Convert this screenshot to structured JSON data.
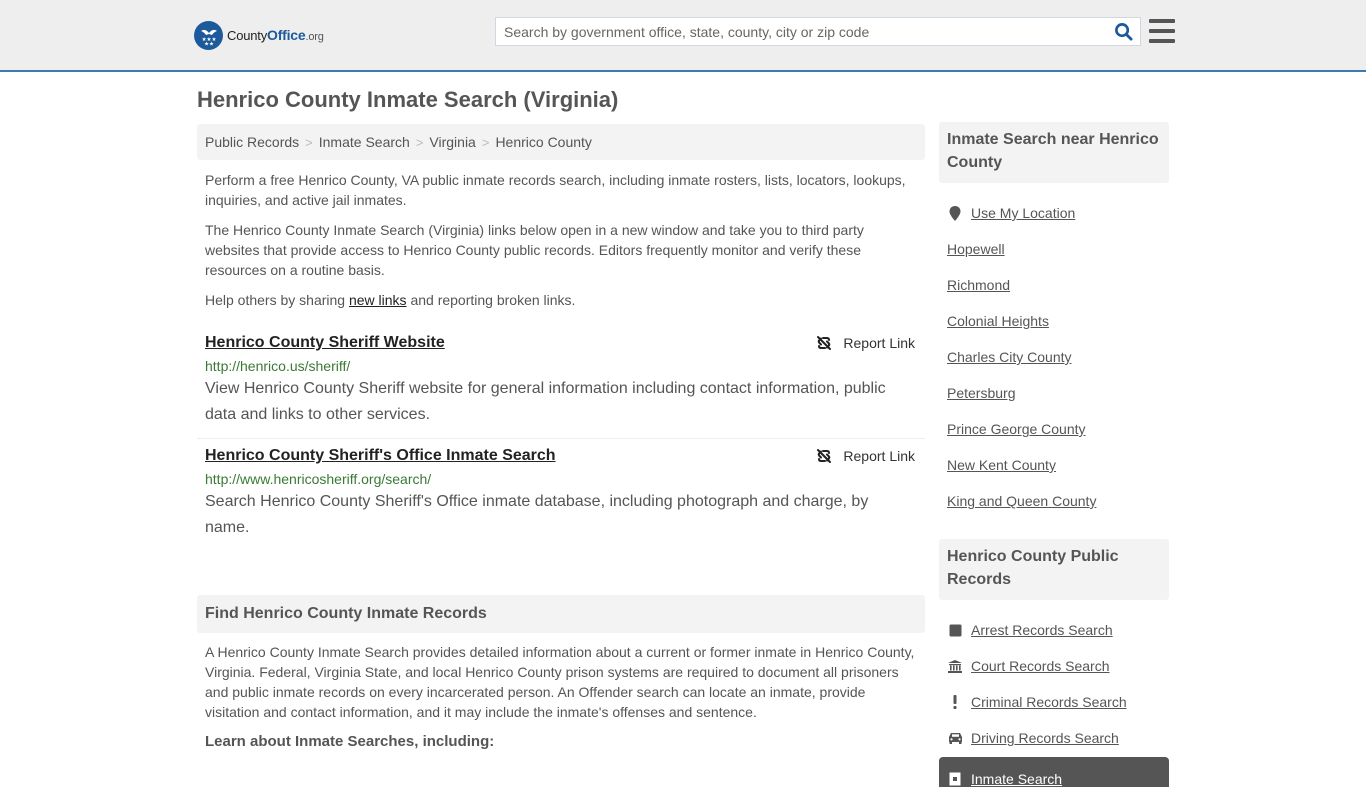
{
  "header": {
    "logo": {
      "name_prefix": "County",
      "name_brand": "Office",
      "name_suffix": ".org"
    },
    "search": {
      "placeholder": "Search by government office, state, county, city or zip code",
      "value": ""
    },
    "icons": {
      "search": "search-icon",
      "menu": "hamburger-menu-icon"
    }
  },
  "page": {
    "title": "Henrico County Inmate Search (Virginia)"
  },
  "breadcrumb": [
    {
      "label": "Public Records"
    },
    {
      "label": "Inmate Search"
    },
    {
      "label": "Virginia"
    },
    {
      "label": "Henrico County"
    }
  ],
  "breadcrumb_separator": ">",
  "intro": {
    "p1": "Perform a free Henrico County, VA public inmate records search, including inmate rosters, lists, locators, lookups, inquiries, and active jail inmates.",
    "p2": "The Henrico County Inmate Search (Virginia) links below open in a new window and take you to third party websites that provide access to Henrico County public records. Editors frequently monitor and verify these resources on a routine basis.",
    "p3_before": "Help others by sharing ",
    "p3_link": "new links",
    "p3_after": " and reporting broken links."
  },
  "links": [
    {
      "title": "Henrico County Sheriff Website",
      "url": "http://henrico.us/sheriff/",
      "description": "View Henrico County Sheriff website for general information including contact information, public data and links to other services.",
      "report_label": "Report Link"
    },
    {
      "title": "Henrico County Sheriff's Office Inmate Search",
      "url": "http://www.henricosheriff.org/search/",
      "description": "Search Henrico County Sheriff's Office inmate database, including photograph and charge, by name.",
      "report_label": "Report Link"
    }
  ],
  "find_section": {
    "heading": "Find Henrico County Inmate Records",
    "body": "A Henrico County Inmate Search provides detailed information about a current or former inmate in Henrico County, Virginia. Federal, Virginia State, and local Henrico County prison systems are required to document all prisoners and public inmate records on every incarcerated person. An Offender search can locate an inmate, provide visitation and contact information, and it may include the inmate's offenses and sentence.",
    "learn_heading": "Learn about Inmate Searches, including:"
  },
  "sidebar": {
    "nearby": {
      "heading": "Inmate Search near Henrico County",
      "use_location": "Use My Location",
      "items": [
        {
          "label": "Hopewell"
        },
        {
          "label": "Richmond"
        },
        {
          "label": "Colonial Heights"
        },
        {
          "label": "Charles City County"
        },
        {
          "label": "Petersburg"
        },
        {
          "label": "Prince George County"
        },
        {
          "label": "New Kent County"
        },
        {
          "label": "King and Queen County"
        }
      ]
    },
    "public_records": {
      "heading": "Henrico County Public Records",
      "items": [
        {
          "label": "Arrest Records Search",
          "icon": "arrest-book-icon"
        },
        {
          "label": "Court Records Search",
          "icon": "courthouse-icon"
        },
        {
          "label": "Criminal Records Search",
          "icon": "exclamation-icon"
        },
        {
          "label": "Driving Records Search",
          "icon": "car-icon"
        }
      ],
      "active": {
        "label": "Inmate Search",
        "icon": "jail-door-icon"
      }
    }
  },
  "colors": {
    "header_bg": "#eeeeee",
    "header_border": "#3b7bb0",
    "brand_blue": "#1c5a9b",
    "url_green": "#3a7a34",
    "panel_bg": "#f3f3f3",
    "active_item_bg": "#555555"
  }
}
